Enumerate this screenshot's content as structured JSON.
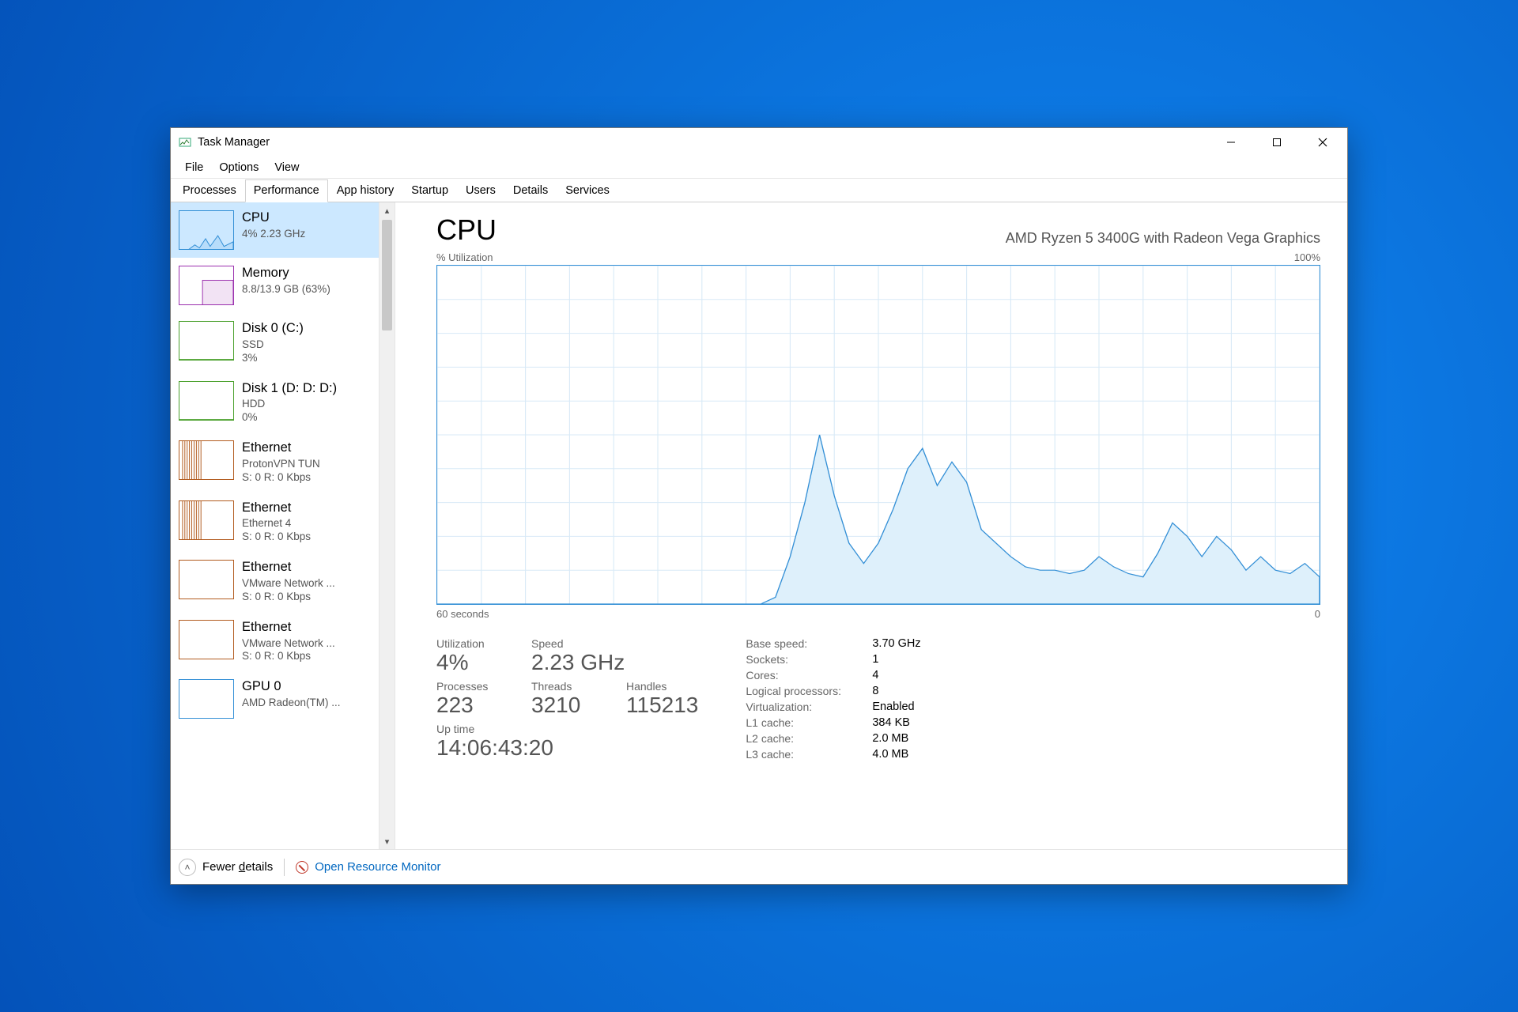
{
  "window": {
    "title": "Task Manager"
  },
  "menu": {
    "file": "File",
    "options": "Options",
    "view": "View"
  },
  "tabs": {
    "processes": "Processes",
    "performance": "Performance",
    "app_history": "App history",
    "startup": "Startup",
    "users": "Users",
    "details": "Details",
    "services": "Services"
  },
  "sidebar": {
    "items": [
      {
        "title": "CPU",
        "sub": "4%  2.23 GHz",
        "color": "#338fd6",
        "kind": "cpu"
      },
      {
        "title": "Memory",
        "sub": "8.8/13.9 GB (63%)",
        "color": "#9b2fae",
        "kind": "mem"
      },
      {
        "title": "Disk 0 (C:)",
        "sub": "SSD\n3%",
        "color": "#4aa02c",
        "kind": "disk"
      },
      {
        "title": "Disk 1 (D: D: D:)",
        "sub": "HDD\n0%",
        "color": "#4aa02c",
        "kind": "disk"
      },
      {
        "title": "Ethernet",
        "sub": "ProtonVPN TUN\nS: 0 R: 0 Kbps",
        "color": "#b25b1f",
        "kind": "net"
      },
      {
        "title": "Ethernet",
        "sub": "Ethernet 4\nS: 0 R: 0 Kbps",
        "color": "#b25b1f",
        "kind": "net"
      },
      {
        "title": "Ethernet",
        "sub": "VMware Network ...\nS: 0 R: 0 Kbps",
        "color": "#b25b1f",
        "kind": "net2"
      },
      {
        "title": "Ethernet",
        "sub": "VMware Network ...\nS: 0 R: 0 Kbps",
        "color": "#b25b1f",
        "kind": "net2"
      },
      {
        "title": "GPU 0",
        "sub": "AMD Radeon(TM) ...",
        "color": "#338fd6",
        "kind": "gpu"
      }
    ]
  },
  "main": {
    "heading": "CPU",
    "subtitle": "AMD Ryzen 5 3400G with Radeon Vega Graphics",
    "y_left": "% Utilization",
    "y_right": "100%",
    "x_left": "60 seconds",
    "x_right": "0"
  },
  "chart_data": {
    "type": "area",
    "title": "CPU % Utilization",
    "xlabel": "seconds ago",
    "ylabel": "% Utilization",
    "xlim": [
      60,
      0
    ],
    "ylim": [
      0,
      100
    ],
    "x": [
      60,
      38,
      37,
      36,
      35,
      34,
      33,
      32,
      31,
      30,
      29,
      28,
      27,
      26,
      25,
      24,
      23,
      22,
      21,
      20,
      19,
      18,
      17,
      16,
      15,
      14,
      13,
      12,
      11,
      10,
      9,
      8,
      7,
      6,
      5,
      4,
      3,
      2,
      1,
      0
    ],
    "values": [
      0,
      0,
      2,
      14,
      30,
      50,
      32,
      18,
      12,
      18,
      28,
      40,
      46,
      35,
      42,
      36,
      22,
      18,
      14,
      11,
      10,
      10,
      9,
      10,
      14,
      11,
      9,
      8,
      15,
      24,
      20,
      14,
      20,
      16,
      10,
      14,
      10,
      9,
      12,
      8
    ]
  },
  "stats": {
    "utilization_label": "Utilization",
    "utilization": "4%",
    "speed_label": "Speed",
    "speed": "2.23 GHz",
    "processes_label": "Processes",
    "processes": "223",
    "threads_label": "Threads",
    "threads": "3210",
    "handles_label": "Handles",
    "handles": "115213",
    "uptime_label": "Up time",
    "uptime": "14:06:43:20",
    "pairs": [
      {
        "k": "Base speed:",
        "v": "3.70 GHz"
      },
      {
        "k": "Sockets:",
        "v": "1"
      },
      {
        "k": "Cores:",
        "v": "4"
      },
      {
        "k": "Logical processors:",
        "v": "8"
      },
      {
        "k": "Virtualization:",
        "v": "Enabled"
      },
      {
        "k": "L1 cache:",
        "v": "384 KB"
      },
      {
        "k": "L2 cache:",
        "v": "2.0 MB"
      },
      {
        "k": "L3 cache:",
        "v": "4.0 MB"
      }
    ]
  },
  "statusbar": {
    "fewer_details_pre": "Fewer ",
    "fewer_details_u": "d",
    "fewer_details_post": "etails",
    "resource_monitor": "Open Resource Monitor"
  }
}
